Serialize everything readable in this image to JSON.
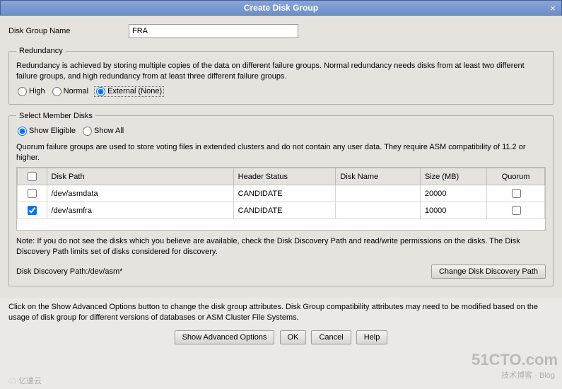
{
  "window": {
    "title": "Create Disk Group",
    "close": "×"
  },
  "disk_group_name": {
    "label": "Disk Group Name",
    "value": "FRA"
  },
  "redundancy": {
    "legend": "Redundancy",
    "desc": "Redundancy is achieved by storing multiple copies of the data on different failure groups. Normal redundancy needs disks from at least two different failure groups, and high redundancy from at least three different failure groups.",
    "options": {
      "high": "High",
      "normal": "Normal",
      "external": "External (None)"
    },
    "selected": "external"
  },
  "member_disks": {
    "legend": "Select Member Disks",
    "filter": {
      "eligible": "Show Eligible",
      "all": "Show All",
      "selected": "eligible"
    },
    "quorum_desc": "Quorum failure groups are used to store voting files in extended clusters and do not contain any user data. They require ASM compatibility of 11.2 or higher.",
    "columns": {
      "path": "Disk Path",
      "hdr": "Header Status",
      "name": "Disk Name",
      "size": "Size (MB)",
      "quorum": "Quorum"
    },
    "rows": [
      {
        "checked": false,
        "path": "/dev/asmdata",
        "hdr": "CANDIDATE",
        "name": "",
        "size": "20000",
        "quorum": false
      },
      {
        "checked": true,
        "path": "/dev/asmfra",
        "hdr": "CANDIDATE",
        "name": "",
        "size": "10000",
        "quorum": false
      }
    ],
    "note": "Note: If you do not see the disks which you believe are available, check the Disk Discovery Path and read/write permissions on the disks. The Disk Discovery Path limits set of disks considered for discovery.",
    "ddp_label": "Disk Discovery Path:",
    "ddp_value": "/dev/asm*",
    "change_ddp_btn": "Change Disk Discovery Path"
  },
  "footer_note": "Click on the Show Advanced Options button to change the disk group attributes. Disk Group compatibility attributes may need to be modified based on the usage of disk group for different versions of databases or ASM Cluster File Systems.",
  "buttons": {
    "advanced": "Show Advanced Options",
    "ok": "OK",
    "cancel": "Cancel",
    "help": "Help"
  },
  "watermark": {
    "main": "51CTO.com",
    "sub": "技术博客 · Blog",
    "left": "☁ 亿速云"
  }
}
